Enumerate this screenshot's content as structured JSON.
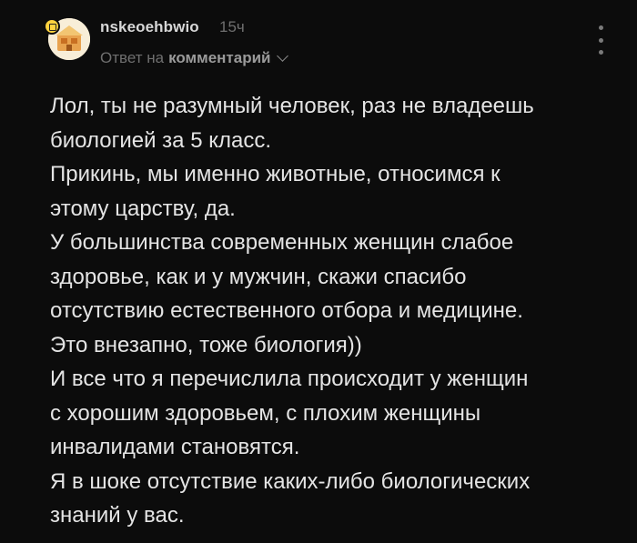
{
  "comment": {
    "author": "nskeoehbwio",
    "time": "15ч",
    "reply_prefix": "Ответ на",
    "reply_target": "комментарий",
    "lines": [
      "Лол, ты не разумный человек, раз не владеешь",
      "биологией за 5 класс.",
      "Прикинь, мы именно животные, относимся к",
      "этому царству, да.",
      "У большинства современных женщин слабое",
      "здоровье, как и у мужчин, скажи спасибо",
      "отсутствию естественного отбора и медицине.",
      "Это внезапно, тоже биология))",
      "И все что я перечислила происходит у женщин",
      "с хорошим здоровьем, с плохим женщины",
      "инвалидами становятся.",
      "Я в шоке отсутствие каких-либо биологических",
      "знаний у вас."
    ]
  },
  "icons": {
    "badge": "premium-badge-icon",
    "more": "more-vertical-icon",
    "chevron": "chevron-down-icon"
  },
  "colors": {
    "background": "#0c0c0c",
    "text": "#e4e4e4",
    "muted": "#6f6f6f",
    "badge": "#ffd23f"
  }
}
